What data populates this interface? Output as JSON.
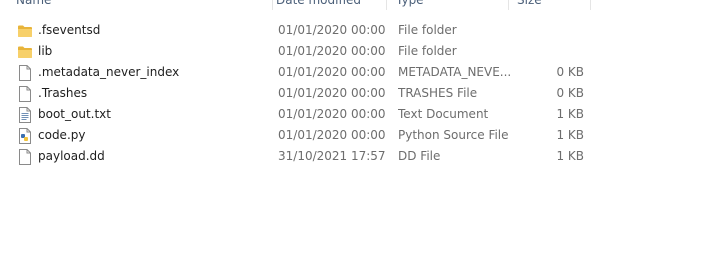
{
  "columns": {
    "name": "Name",
    "date_modified": "Date modified",
    "type": "Type",
    "size": "Size"
  },
  "files": [
    {
      "icon": "folder-icon",
      "name": ".fseventsd",
      "date": "01/01/2020 00:00",
      "type": "File folder",
      "size": ""
    },
    {
      "icon": "folder-icon",
      "name": "lib",
      "date": "01/01/2020 00:00",
      "type": "File folder",
      "size": ""
    },
    {
      "icon": "document-icon",
      "name": ".metadata_never_index",
      "date": "01/01/2020 00:00",
      "type": "METADATA_NEVE...",
      "size": "0 KB"
    },
    {
      "icon": "document-icon",
      "name": ".Trashes",
      "date": "01/01/2020 00:00",
      "type": "TRASHES File",
      "size": "0 KB"
    },
    {
      "icon": "text-file-icon",
      "name": "boot_out.txt",
      "date": "01/01/2020 00:00",
      "type": "Text Document",
      "size": "1 KB"
    },
    {
      "icon": "python-file-icon",
      "name": "code.py",
      "date": "01/01/2020 00:00",
      "type": "Python Source File",
      "size": "1 KB"
    },
    {
      "icon": "document-icon",
      "name": "payload.dd",
      "date": "31/10/2021 17:57",
      "type": "DD File",
      "size": "1 KB"
    }
  ]
}
